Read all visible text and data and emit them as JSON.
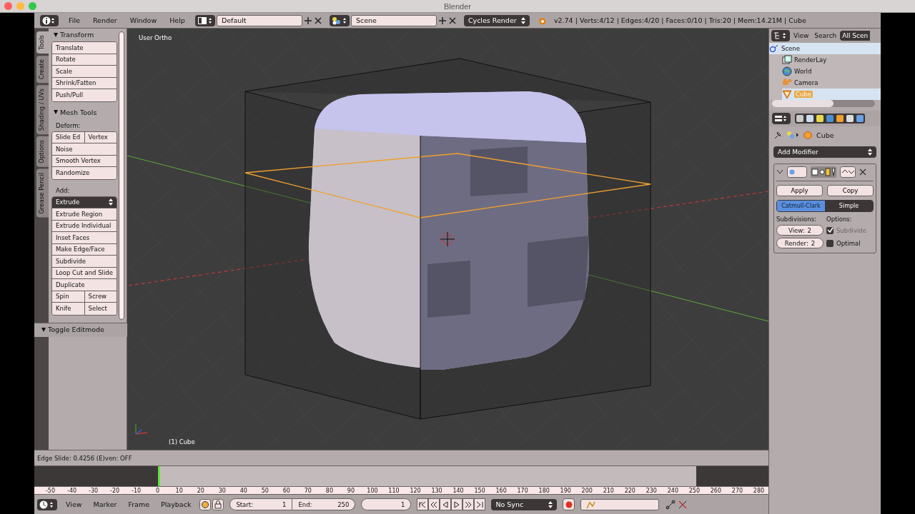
{
  "window": {
    "title": "Blender"
  },
  "header": {
    "menus": [
      "File",
      "Render",
      "Window",
      "Help"
    ],
    "layout": "Default",
    "scene": "Scene",
    "engine": "Cycles Render",
    "stats": "v2.74 | Verts:4/12 | Edges:4/20 | Faces:0/10 | Tris:20 | Mem:14.21M | Cube"
  },
  "tool_tabs": [
    {
      "label": "Tools",
      "selected": true
    },
    {
      "label": "Create",
      "selected": false
    },
    {
      "label": "Shading / UVs",
      "selected": false
    },
    {
      "label": "Options",
      "selected": false
    },
    {
      "label": "Grease Pencil",
      "selected": false
    }
  ],
  "tool_panels": [
    {
      "title": "Transform",
      "groups": [
        {
          "rows": [
            {
              "kind": "button",
              "labels": [
                "Translate"
              ]
            },
            {
              "kind": "button",
              "labels": [
                "Rotate"
              ]
            },
            {
              "kind": "button",
              "labels": [
                "Scale"
              ]
            },
            {
              "kind": "button",
              "labels": [
                "Shrink/Fatten"
              ]
            },
            {
              "kind": "button",
              "labels": [
                "Push/Pull"
              ]
            }
          ]
        }
      ]
    },
    {
      "title": "Mesh Tools",
      "groups": [
        {
          "label": "Deform:",
          "rows": [
            {
              "kind": "button",
              "labels": [
                "Slide Ed",
                "Vertex"
              ]
            },
            {
              "kind": "button",
              "labels": [
                "Noise"
              ]
            },
            {
              "kind": "button",
              "labels": [
                "Smooth Vertex"
              ]
            },
            {
              "kind": "button",
              "labels": [
                "Randomize"
              ]
            }
          ]
        },
        {
          "label": "Add:",
          "rows": [
            {
              "kind": "dropdown",
              "labels": [
                "Extrude"
              ]
            },
            {
              "kind": "button",
              "labels": [
                "Extrude Region"
              ]
            },
            {
              "kind": "button",
              "labels": [
                "Extrude Individual"
              ]
            },
            {
              "kind": "button",
              "labels": [
                "Inset Faces"
              ]
            },
            {
              "kind": "button",
              "labels": [
                "Make Edge/Face"
              ]
            },
            {
              "kind": "button",
              "labels": [
                "Subdivide"
              ]
            },
            {
              "kind": "button",
              "labels": [
                "Loop Cut and Slide"
              ]
            },
            {
              "kind": "button",
              "labels": [
                "Duplicate"
              ]
            },
            {
              "kind": "button",
              "labels": [
                "Spin",
                "Screw"
              ]
            },
            {
              "kind": "button",
              "labels": [
                "Knife",
                "Select"
              ]
            }
          ]
        }
      ]
    }
  ],
  "collapsed_panel": {
    "title": "Toggle Editmode"
  },
  "viewport": {
    "view_name": "User Ortho",
    "object_label": "(1) Cube"
  },
  "status_text": "Edge Slide: 0.4256 (E)ven: OFF",
  "timeline": {
    "ruler": [
      "-50",
      "-40",
      "-30",
      "-20",
      "-10",
      "0",
      "10",
      "20",
      "30",
      "40",
      "50",
      "60",
      "70",
      "80",
      "90",
      "100",
      "110",
      "120",
      "130",
      "140",
      "150",
      "160",
      "170",
      "180",
      "190",
      "200",
      "210",
      "220",
      "230",
      "240",
      "250",
      "260",
      "270",
      "280"
    ]
  },
  "timeline_header": {
    "menus": [
      "View",
      "Marker",
      "Frame",
      "Playback"
    ],
    "start_label": "Start:",
    "start": "1",
    "end_label": "End:",
    "end": "250",
    "current_frame": "1",
    "sync": "No Sync"
  },
  "outliner": {
    "menus": [
      "View",
      "Search"
    ],
    "filter": "All Scen",
    "tree": [
      {
        "label": "Scene",
        "kind": "scene",
        "selected": true,
        "children": [
          {
            "label": "RenderLay",
            "kind": "layers",
            "selected": false
          },
          {
            "label": "World",
            "kind": "world",
            "selected": false
          },
          {
            "label": "Camera",
            "kind": "camera",
            "selected": false
          },
          {
            "label": "Cube",
            "kind": "mesh",
            "selected": true
          }
        ]
      }
    ]
  },
  "properties": {
    "breadcrumb": "Cube",
    "add_modifier": "Add Modifier",
    "actions": [
      "Apply",
      "Copy"
    ],
    "types": [
      {
        "label": "Catmull-Clark",
        "selected": true
      },
      {
        "label": "Simple",
        "selected": false
      }
    ],
    "subdivisions_label": "Subdivisions:",
    "fields": [
      {
        "label": "View:",
        "value": "2"
      },
      {
        "label": "Render:",
        "value": "2"
      }
    ],
    "options_label": "Options:",
    "options": [
      {
        "label": "Subdivide",
        "checked": true,
        "disabled": true
      },
      {
        "label": "Optimal",
        "checked": false,
        "disabled": false
      }
    ]
  }
}
